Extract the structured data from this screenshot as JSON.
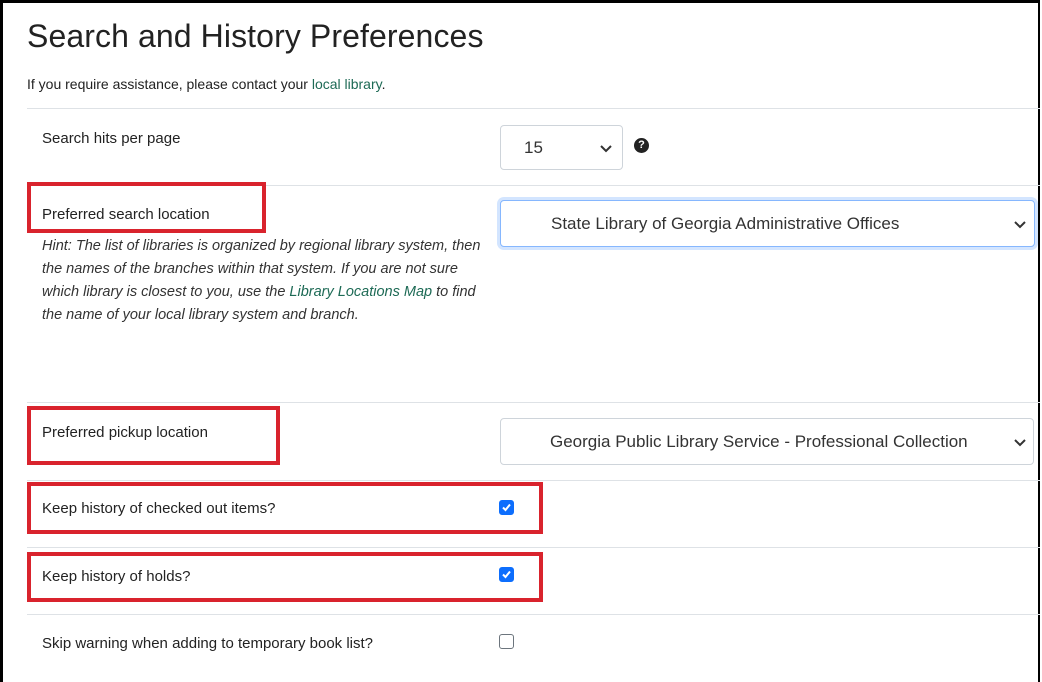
{
  "page": {
    "title": "Search and History Preferences",
    "assist_prefix": "If you require assistance, please contact your ",
    "assist_link": "local library",
    "assist_suffix": "."
  },
  "prefs": {
    "hits_per_page": {
      "label": "Search hits per page",
      "value": "15",
      "help_icon": "question-circle-icon"
    },
    "search_location": {
      "label": "Preferred search location",
      "value": "State Library of Georgia Administrative Offices",
      "hint_prefix": "Hint: The list of libraries is organized by regional library system, then the names of the branches within that system. If you are not sure which library is closest to you, use the ",
      "hint_link": "Library Locations Map",
      "hint_suffix": " to find the name of your local library system and branch."
    },
    "pickup_location": {
      "label": "Preferred pickup location",
      "value": "Georgia Public Library Service - Professional Collection"
    },
    "keep_checkout_history": {
      "label": "Keep history of checked out items?",
      "checked": true
    },
    "keep_holds_history": {
      "label": "Keep history of holds?",
      "checked": true
    },
    "skip_warning": {
      "label": "Skip warning when adding to temporary book list?",
      "checked": false
    }
  },
  "colors": {
    "highlight": "#d9232d",
    "link": "#1d6a55",
    "checkbox_checked": "#0d6efd"
  }
}
